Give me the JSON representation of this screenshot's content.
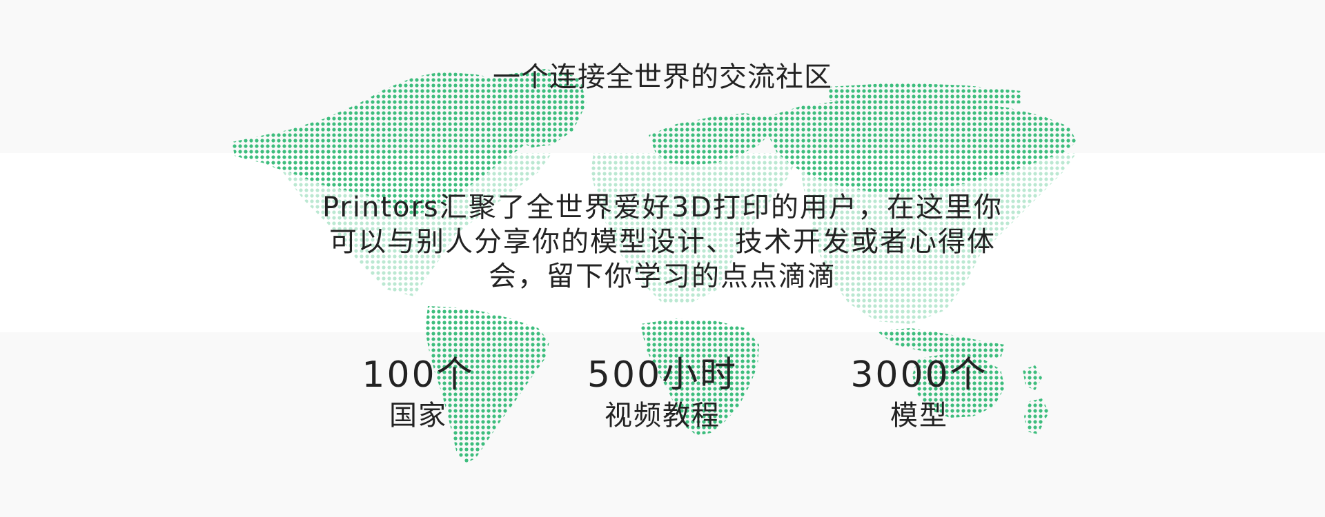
{
  "headline": "一个连接全世界的交流社区",
  "description": "Printors汇聚了全世界爱好3D打印的用户，在这里你可以与别人分享你的模型设计、技术开发或者心得体会，留下你学习的点点滴滴",
  "stats": [
    {
      "value": "100个",
      "label": "国家"
    },
    {
      "value": "500小时",
      "label": "视频教程"
    },
    {
      "value": "3000个",
      "label": "模型"
    }
  ],
  "colors": {
    "background": "#f9f9f9",
    "band": "#ffffff",
    "dot": "#3dbd7d",
    "text": "#222222"
  },
  "decoration": "world-map-dots"
}
